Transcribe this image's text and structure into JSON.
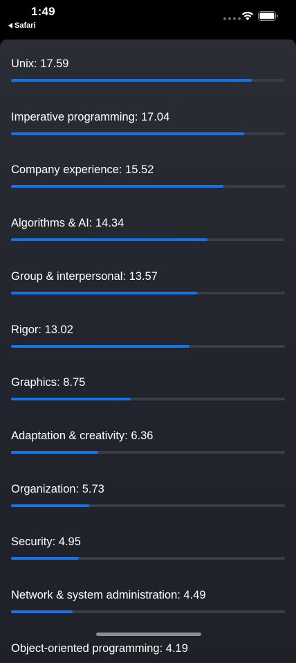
{
  "status_bar": {
    "time": "1:49",
    "back_label": "Safari",
    "wifi_icon": "wifi-icon",
    "battery_icon": "battery-icon"
  },
  "colors": {
    "bar_fill": "#1473e6",
    "bar_track": "#3a3c46",
    "sheet_bg": "#2b2d36"
  },
  "scale_max": 20,
  "scores": [
    {
      "label": "Unix: 17.59",
      "value": 17.59
    },
    {
      "label": "Imperative programming: 17.04",
      "value": 17.04
    },
    {
      "label": "Company experience: 15.52",
      "value": 15.52
    },
    {
      "label": "Algorithms & AI: 14.34",
      "value": 14.34
    },
    {
      "label": "Group & interpersonal: 13.57",
      "value": 13.57
    },
    {
      "label": "Rigor: 13.02",
      "value": 13.02
    },
    {
      "label": "Graphics: 8.75",
      "value": 8.75
    },
    {
      "label": "Adaptation & creativity: 6.36",
      "value": 6.36
    },
    {
      "label": "Organization: 5.73",
      "value": 5.73
    },
    {
      "label": "Security: 4.95",
      "value": 4.95
    },
    {
      "label": "Network & system administration: 4.49",
      "value": 4.49
    },
    {
      "label": "Object-oriented programming: 4.19",
      "value": 4.19
    }
  ]
}
